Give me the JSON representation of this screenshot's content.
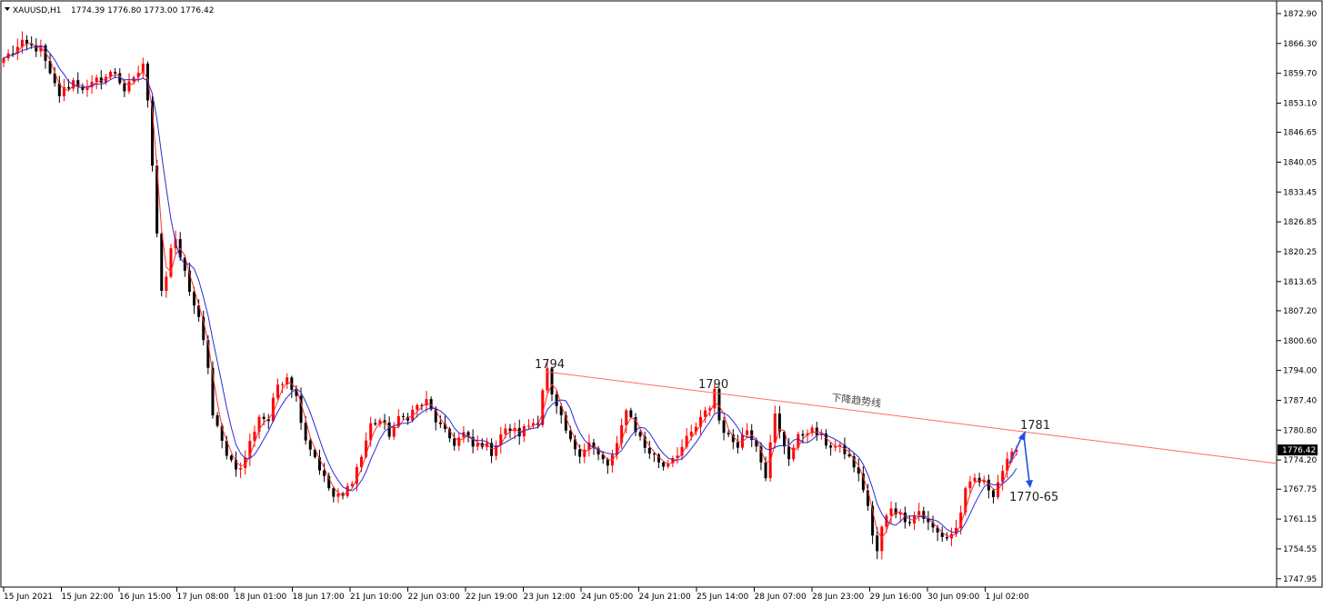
{
  "header": {
    "symbol": "XAUUSD,H1",
    "ohlc": "1774.39 1776.80 1773.00 1776.42",
    "menu_icon": "triangle-down-icon"
  },
  "colors": {
    "bull": "#ff0000",
    "bear": "#000000",
    "ma_fast": "#ff3030",
    "ma_slow": "#2b2bd6",
    "trendline": "#ff6a6a",
    "arrow": "#1f4fe0",
    "price_tag_bg": "#000000"
  },
  "chart_data": {
    "type": "candlestick",
    "symbol": "XAUUSD",
    "timeframe": "H1",
    "y_ticks": [
      "1872.90",
      "1866.30",
      "1859.70",
      "1853.10",
      "1846.65",
      "1840.05",
      "1833.45",
      "1826.85",
      "1820.25",
      "1813.65",
      "1807.20",
      "1800.60",
      "1794.00",
      "1787.40",
      "1780.80",
      "1774.20",
      "1767.75",
      "1761.15",
      "1754.55",
      "1747.95"
    ],
    "ylim": [
      1746.3,
      1875.5
    ],
    "x_ticks": [
      "15 Jun 2021",
      "15 Jun 22:00",
      "16 Jun 15:00",
      "17 Jun 08:00",
      "18 Jun 01:00",
      "18 Jun 17:00",
      "21 Jun 10:00",
      "22 Jun 03:00",
      "22 Jun 19:00",
      "23 Jun 12:00",
      "24 Jun 05:00",
      "24 Jun 21:00",
      "25 Jun 14:00",
      "28 Jun 07:00",
      "28 Jun 23:00",
      "29 Jun 16:00",
      "30 Jun 09:00",
      "1 Jul 02:00"
    ],
    "current_price": "1776.42",
    "close_path": [
      [
        0,
        1863
      ],
      [
        4,
        1866
      ],
      [
        8,
        1865
      ],
      [
        10,
        1859
      ],
      [
        12,
        1855
      ],
      [
        15,
        1858
      ],
      [
        18,
        1856
      ],
      [
        20,
        1858
      ],
      [
        24,
        1860
      ],
      [
        26,
        1856
      ],
      [
        28,
        1858
      ],
      [
        30,
        1862
      ],
      [
        31,
        1853
      ],
      [
        32,
        1840
      ],
      [
        33,
        1825
      ],
      [
        34,
        1812
      ],
      [
        35,
        1815
      ],
      [
        36,
        1821
      ],
      [
        37,
        1822
      ],
      [
        38,
        1819
      ],
      [
        40,
        1812
      ],
      [
        42,
        1805
      ],
      [
        44,
        1795
      ],
      [
        45,
        1784
      ],
      [
        47,
        1778
      ],
      [
        49,
        1774
      ],
      [
        51,
        1772
      ],
      [
        53,
        1778
      ],
      [
        55,
        1784
      ],
      [
        57,
        1783
      ],
      [
        59,
        1791
      ],
      [
        61,
        1793
      ],
      [
        63,
        1788
      ],
      [
        65,
        1779
      ],
      [
        67,
        1775
      ],
      [
        69,
        1770
      ],
      [
        71,
        1766
      ],
      [
        73,
        1766
      ],
      [
        75,
        1770
      ],
      [
        77,
        1775
      ],
      [
        79,
        1782
      ],
      [
        81,
        1783
      ],
      [
        83,
        1780
      ],
      [
        85,
        1783
      ],
      [
        87,
        1784
      ],
      [
        89,
        1786
      ],
      [
        91,
        1787
      ],
      [
        93,
        1783
      ],
      [
        95,
        1780
      ],
      [
        97,
        1778
      ],
      [
        99,
        1780
      ],
      [
        101,
        1777
      ],
      [
        103,
        1778
      ],
      [
        105,
        1776
      ],
      [
        107,
        1780
      ],
      [
        109,
        1781
      ],
      [
        111,
        1780
      ],
      [
        113,
        1782
      ],
      [
        115,
        1783
      ],
      [
        116,
        1790
      ],
      [
        117,
        1794
      ],
      [
        118,
        1788
      ],
      [
        120,
        1783
      ],
      [
        122,
        1778
      ],
      [
        124,
        1776
      ],
      [
        126,
        1778
      ],
      [
        128,
        1775
      ],
      [
        130,
        1773
      ],
      [
        132,
        1777
      ],
      [
        134,
        1786
      ],
      [
        136,
        1781
      ],
      [
        138,
        1777
      ],
      [
        140,
        1775
      ],
      [
        142,
        1773
      ],
      [
        144,
        1775
      ],
      [
        146,
        1777
      ],
      [
        148,
        1780
      ],
      [
        150,
        1783
      ],
      [
        152,
        1786
      ],
      [
        153,
        1790
      ],
      [
        154,
        1783
      ],
      [
        156,
        1779
      ],
      [
        158,
        1778
      ],
      [
        160,
        1781
      ],
      [
        162,
        1778
      ],
      [
        164,
        1771
      ],
      [
        166,
        1784
      ],
      [
        167,
        1780
      ],
      [
        169,
        1775
      ],
      [
        171,
        1779
      ],
      [
        173,
        1781
      ],
      [
        175,
        1780
      ],
      [
        177,
        1778
      ],
      [
        179,
        1777
      ],
      [
        181,
        1776
      ],
      [
        183,
        1773
      ],
      [
        185,
        1768
      ],
      [
        186,
        1764
      ],
      [
        187,
        1757
      ],
      [
        188,
        1754
      ],
      [
        189,
        1759
      ],
      [
        191,
        1764
      ],
      [
        193,
        1762
      ],
      [
        195,
        1761
      ],
      [
        197,
        1763
      ],
      [
        199,
        1760
      ],
      [
        201,
        1758
      ],
      [
        203,
        1757
      ],
      [
        205,
        1759
      ],
      [
        207,
        1767
      ],
      [
        209,
        1770
      ],
      [
        211,
        1769
      ],
      [
        213,
        1767
      ],
      [
        215,
        1772
      ],
      [
        217,
        1775
      ],
      [
        218,
        1776.42
      ]
    ]
  },
  "annotations": {
    "peak1": "1794",
    "peak2": "1790",
    "trend_text": "下降趋势线",
    "target_up": "1781",
    "target_down": "1770-65"
  }
}
